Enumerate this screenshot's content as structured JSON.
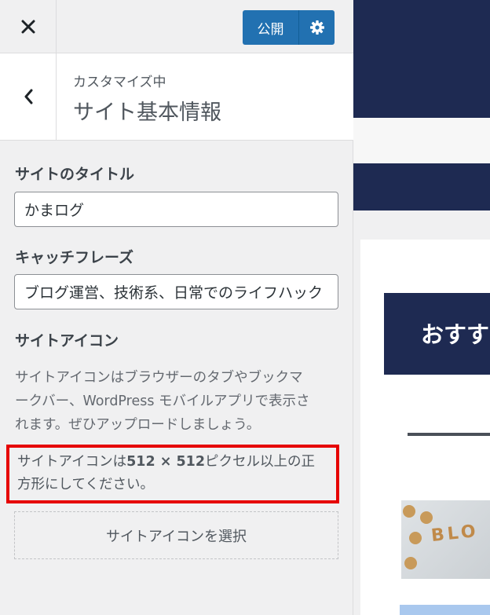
{
  "topbar": {
    "close_icon": "close-icon",
    "publish_label": "公開",
    "settings_icon": "gear-icon"
  },
  "section": {
    "back_icon": "chevron-left-icon",
    "customizing_label": "カスタマイズ中",
    "title": "サイト基本情報"
  },
  "site_title": {
    "label": "サイトのタイトル",
    "value": "かまログ"
  },
  "tagline": {
    "label": "キャッチフレーズ",
    "value": "ブログ運営、技術系、日常でのライフハック"
  },
  "site_icon": {
    "label": "サイトアイコン",
    "description_lines": [
      "サイトアイコンはブラウザーのタブやブックマ",
      "ークバー、WordPress モバイルアプリで表示さ",
      "れます。ぜひアップロードしましょう。"
    ],
    "notice_line1_prefix": "サイトアイコンは",
    "notice_size": "512 × 512",
    "notice_line1_suffix": "ピクセル以上の正",
    "notice_line2": "方形にしてください。",
    "select_button_label": "サイトアイコンを選択"
  },
  "preview": {
    "banner_text": "おすす",
    "thumb_text": "BLO"
  },
  "colors": {
    "primary": "#2271b1",
    "preview_navy": "#1e2a52",
    "highlight": "#e60000"
  }
}
